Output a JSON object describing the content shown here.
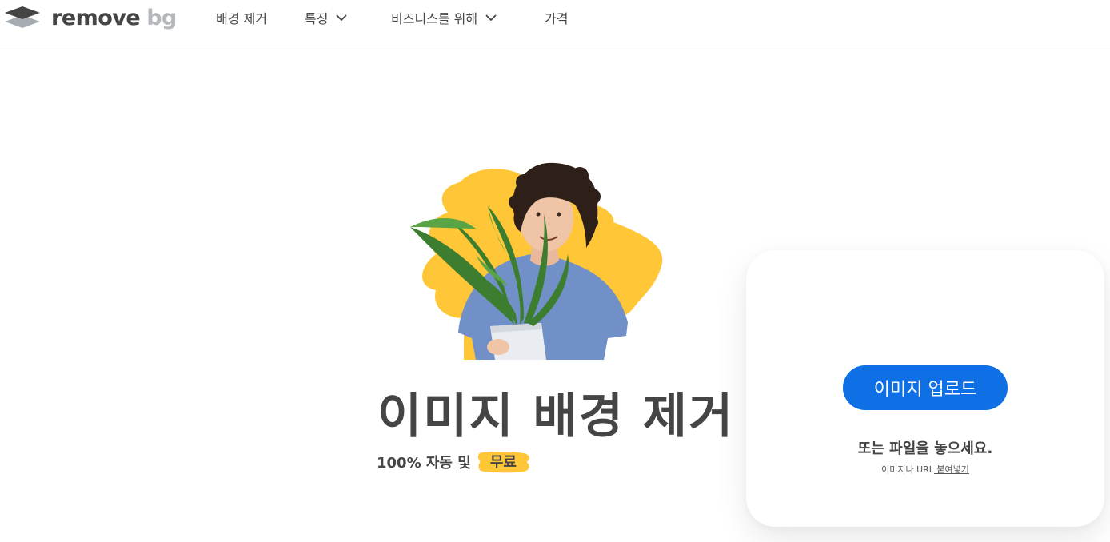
{
  "brand": {
    "name_primary": "remove",
    "name_secondary": "bg"
  },
  "nav": {
    "items": [
      {
        "label": "배경 제거",
        "has_dropdown": false
      },
      {
        "label": "특징",
        "has_dropdown": true
      },
      {
        "label": "비즈니스를 위해",
        "has_dropdown": true
      },
      {
        "label": "가격",
        "has_dropdown": false
      }
    ]
  },
  "hero": {
    "title": "이미지 배경 제거",
    "subtitle_prefix": "100% 자동 및",
    "subtitle_highlight": "무료",
    "illustration": "man-holding-plant-on-yellow-blob"
  },
  "upload": {
    "button_label": "이미지 업로드",
    "drop_text": "또는 파일을 놓으세요.",
    "url_prefix": "이미지나 URL",
    "url_link": " 붙여넣기"
  },
  "colors": {
    "accent": "#0f70e6",
    "highlight": "#ffc737",
    "text": "#454545",
    "logo_secondary": "#b4b8bd"
  }
}
